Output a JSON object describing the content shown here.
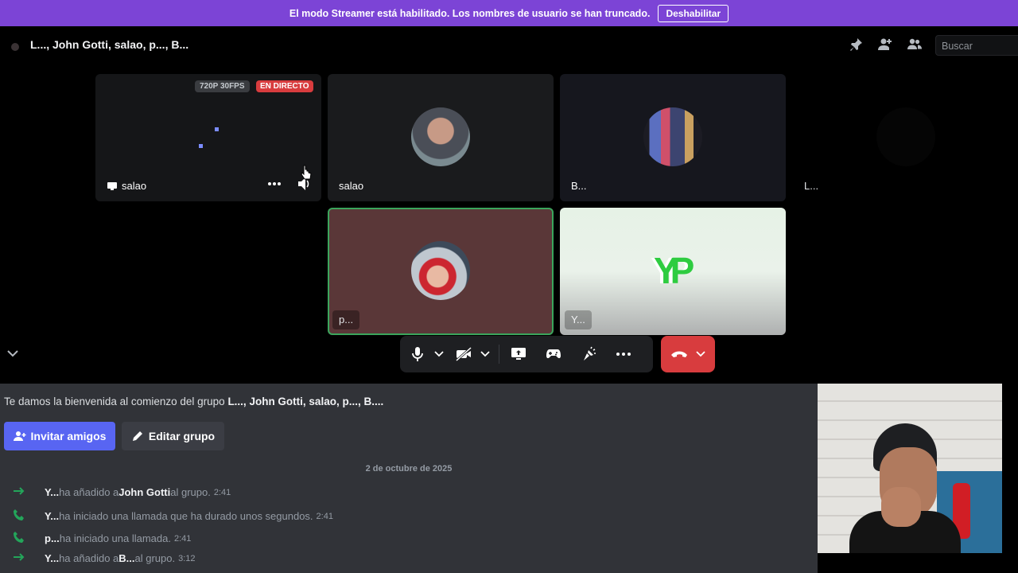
{
  "banner": {
    "message": "El modo Streamer está habilitado. Los nombres de usuario se han truncado.",
    "button": "Deshabilitar"
  },
  "header": {
    "title": "L..., John Gotti, salao, p..., B...",
    "search_placeholder": "Buscar"
  },
  "tiles": [
    {
      "label": "salao",
      "badge_quality": "720P 30FPS",
      "badge_live": "EN DIRECTO",
      "type": "stream"
    },
    {
      "label": "salao",
      "type": "avatar"
    },
    {
      "label": "B...",
      "type": "avatar"
    },
    {
      "label": "L...",
      "type": "empty"
    },
    {
      "label": "p...",
      "type": "avatar",
      "speaking": true
    },
    {
      "label": "Y...",
      "type": "logo",
      "logo_text": "YP"
    }
  ],
  "icons": [
    "pin-icon",
    "add-friend-icon",
    "members-icon",
    "mic-icon",
    "camera-off-icon",
    "screen-share-icon",
    "activity-icon",
    "soundboard-icon",
    "more-icon",
    "hangup-icon",
    "chevron-down-icon",
    "arrow-right-icon",
    "phone-icon"
  ],
  "colors": {
    "banner": "#7c44d6",
    "accent": "#5865f2",
    "hangup": "#d83c3e",
    "join_arrow": "#23a55a",
    "speaking_border": "#3ba55c"
  },
  "chat": {
    "welcome_prefix": "Te damos la bienvenida al comienzo del grupo ",
    "welcome_group": "L..., John Gotti, salao, p..., B....",
    "invite_button": "Invitar amigos",
    "edit_button": "Editar grupo",
    "date": "2 de octubre de 2025",
    "messages": [
      {
        "icon": "arrow-right-icon",
        "user": "Y...",
        "text": " ha añadido a ",
        "target": "John Gotti",
        "suffix": " al grupo.",
        "time": "2:41"
      },
      {
        "icon": "phone-icon",
        "user": "Y...",
        "text": " ha iniciado una llamada que ha durado unos segundos.",
        "target": "",
        "suffix": "",
        "time": "2:41"
      },
      {
        "icon": "phone-icon",
        "user": "p...",
        "text": " ha iniciado una llamada.",
        "target": "",
        "suffix": "",
        "time": "2:41"
      },
      {
        "icon": "arrow-right-icon",
        "user": "Y...",
        "text": " ha añadido a ",
        "target": "B...",
        "suffix": " al grupo.",
        "time": "3:12"
      }
    ]
  }
}
